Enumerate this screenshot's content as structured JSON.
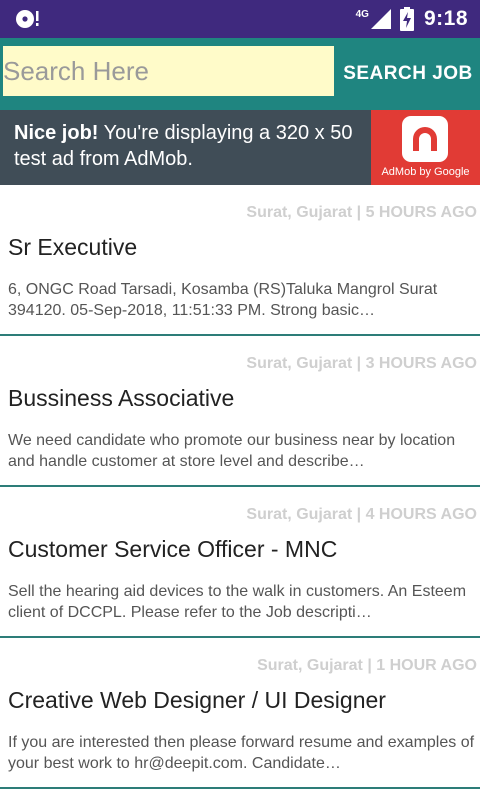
{
  "status_bar": {
    "network": "4G",
    "time": "9:18",
    "left_icon": "cd-notification-icon",
    "signal_icon": "signal-icon",
    "battery_icon": "battery-charging-icon"
  },
  "search": {
    "placeholder": "Search Here",
    "value": "",
    "button_label": "SEARCH JOB"
  },
  "ad": {
    "headline": "Nice job!",
    "body": " You're displaying a 320 x 50 test ad from AdMob.",
    "logo_label": "AdMob by Google",
    "logo_icon": "admob-logo-icon"
  },
  "jobs": [
    {
      "meta": "Surat, Gujarat | 5 HOURS AGO",
      "title": "Sr Executive",
      "description": "6, ONGC Road Tarsadi, Kosamba (RS)Taluka Mangrol Surat 394120. 05-Sep-2018, 11:51:33 PM. Strong basic…"
    },
    {
      "meta": "Surat, Gujarat | 3 HOURS AGO",
      "title": "Bussiness Associative",
      "description": "We need candidate who promote our business near by location and handle customer at store level and describe…"
    },
    {
      "meta": "Surat, Gujarat | 4 HOURS AGO",
      "title": "Customer Service Officer - MNC",
      "description": "Sell the hearing aid devices to the walk in customers. An Esteem client of DCCPL. Please refer to the Job descripti…"
    },
    {
      "meta": "Surat, Gujarat | 1 HOUR AGO",
      "title": "Creative Web Designer / UI Designer",
      "description": "If you are interested then please forward resume and examples of your best work to hr@deepit.com. Candidate…"
    }
  ],
  "colors": {
    "status_bar": "#3f297e",
    "toolbar": "#1f8580",
    "search_field": "#fffbc9",
    "ad_background": "#404d57",
    "ad_logo": "#e13b35",
    "divider": "#2d7d78"
  }
}
